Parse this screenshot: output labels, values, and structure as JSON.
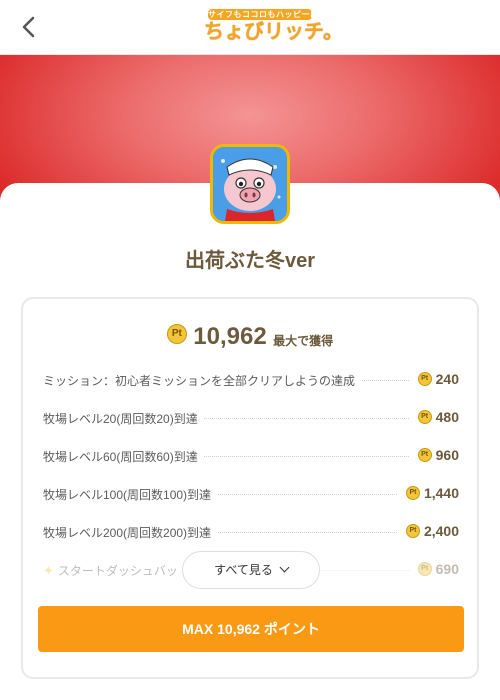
{
  "header": {
    "back_icon": "chevron-left-icon",
    "logo_tagline": "サイフもココロもハッピーに!",
    "logo_name": "ちょびリッチ。"
  },
  "colors": {
    "banner_red": "#dc2b2b",
    "cta_orange": "#fa9a14",
    "text_brown": "#6b5a3c",
    "coin_gold": "#f3c53b"
  },
  "app": {
    "title": "出荷ぶた冬ver",
    "icon": "pig-character-icon"
  },
  "reward": {
    "coin_label": "Pt",
    "total_points": "10,962",
    "total_suffix": "最大で獲得"
  },
  "missions": [
    {
      "label": "ミッション：初心者ミッションを全部クリアしようの達成",
      "points": "240"
    },
    {
      "label": "牧場レベル20(周回数20)到達",
      "points": "480"
    },
    {
      "label": "牧場レベル60(周回数60)到達",
      "points": "960"
    },
    {
      "label": "牧場レベル100(周回数100)到達",
      "points": "1,440"
    },
    {
      "label": "牧場レベル200(周回数200)到達",
      "points": "2,400"
    },
    {
      "label": "スタートダッシュバッ",
      "points": "690",
      "icon": "sparkle-icon"
    }
  ],
  "see_all_label": "すべて見る",
  "cta_label": "MAX 10,962 ポイント"
}
